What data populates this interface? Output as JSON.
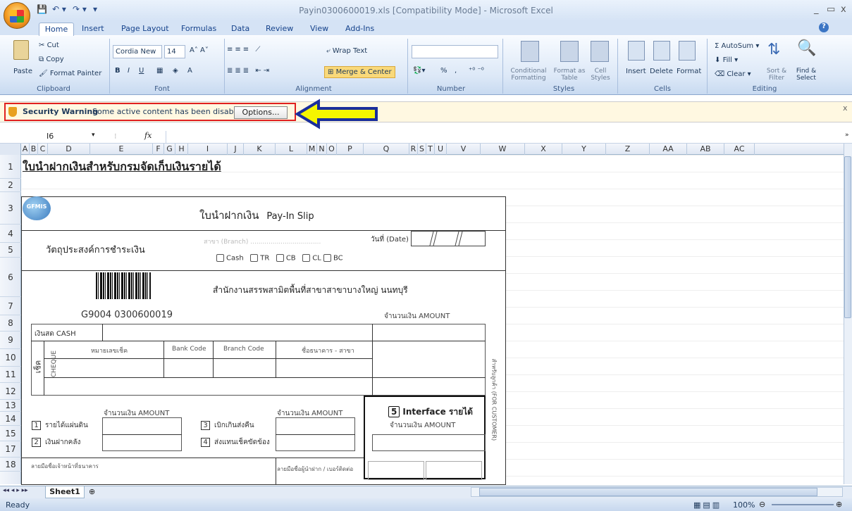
{
  "window": {
    "title": "Payin0300600019.xls  [Compatibility Mode]  -  Microsoft Excel",
    "min": "_",
    "restore": "▭",
    "close": "x",
    "help": "?"
  },
  "tabs": [
    "Home",
    "Insert",
    "Page Layout",
    "Formulas",
    "Data",
    "Review",
    "View",
    "Add-Ins"
  ],
  "ribbon": {
    "clipboard": {
      "label": "Clipboard",
      "paste": "Paste",
      "cut": "Cut",
      "copy": "Copy",
      "format_painter": "Format Painter"
    },
    "font": {
      "label": "Font",
      "name": "Cordia New",
      "size": "14"
    },
    "alignment": {
      "label": "Alignment",
      "wrap": "Wrap Text",
      "merge": "Merge & Center"
    },
    "number": {
      "label": "Number",
      "format": "",
      "percent": "%",
      "comma": ","
    },
    "styles": {
      "label": "Styles",
      "cond": "Conditional Formatting",
      "format_table": "Format as Table",
      "cell_styles": "Cell Styles"
    },
    "cells": {
      "label": "Cells",
      "insert": "Insert",
      "delete": "Delete",
      "format": "Format"
    },
    "editing": {
      "label": "Editing",
      "autosum": "AutoSum",
      "fill": "Fill",
      "clear": "Clear",
      "sort": "Sort & Filter",
      "find": "Find & Select"
    }
  },
  "security": {
    "title": "Security Warning",
    "message": "Some active content has been disabled.",
    "options": "Options..."
  },
  "formula_bar": {
    "cell": "I6",
    "fx": "fx",
    "value": ""
  },
  "columns": [
    "A",
    "B",
    "C",
    "D",
    "E",
    "F",
    "G",
    "H",
    "I",
    "J",
    "K",
    "L",
    "M",
    "N",
    "O",
    "P",
    "Q",
    "R",
    "S",
    "T",
    "U",
    "V",
    "W",
    "X",
    "Y",
    "Z",
    "AA",
    "AB",
    "AC"
  ],
  "rows": [
    "1",
    "2",
    "3",
    "4",
    "5",
    "6",
    "7",
    "8",
    "9",
    "10",
    "11",
    "12",
    "13",
    "14",
    "15",
    "17",
    "18"
  ],
  "sheet": {
    "heading": "ใบนำฝากเงินสำหรับกรมจัดเก็บเงินรายได้",
    "logo": "GFMIS",
    "slip_title": "ใบนำฝากเงิน",
    "slip_title_en": "Pay-In Slip",
    "branch": "สาขา (Branch)",
    "date": "วันที่ (Date)",
    "purpose": "วัตถุประสงค์การชำระเงิน",
    "pay_types": [
      "Cash",
      "TR",
      "CB",
      "CL",
      "BC"
    ],
    "office": "สำนักงานสรรพสามิตพื้นที่สาขาสาขาบางใหญ่ นนทบุรี",
    "ref": "G9004 0300600019",
    "amount_label": "จำนวนเงิน  AMOUNT",
    "cash": "เงินสด CASH",
    "cheque_no": "หมายเลขเช็ค",
    "bank_code": "Bank Code",
    "branch_code": "Branch Code",
    "bank_name": "ชื่อธนาคาร - สาขา",
    "cheque_th": "เช็ค",
    "cheque_en": "CHEQUE",
    "customer_note": "สำหรับลูกค้า (FOR CUSTOMER)",
    "items": [
      {
        "no": "1",
        "label": "รายได้แผ่นดิน"
      },
      {
        "no": "2",
        "label": "เงินฝากคลัง"
      },
      {
        "no": "3",
        "label": "เบิกเกินส่งคืน"
      },
      {
        "no": "4",
        "label": "ส่งแทนเช็คขัดข้อง"
      }
    ],
    "interface_no": "5",
    "interface": "Interface  รายได้",
    "sign_bank": "ลายมือชื่อเจ้าหน้าที่ธนาคาร",
    "sign_depositor": "ลายมือชื่อผู้นำฝาก / เบอร์ติดต่อ"
  },
  "sheet_tab": "Sheet1",
  "status": {
    "ready": "Ready",
    "zoom": "100%"
  }
}
